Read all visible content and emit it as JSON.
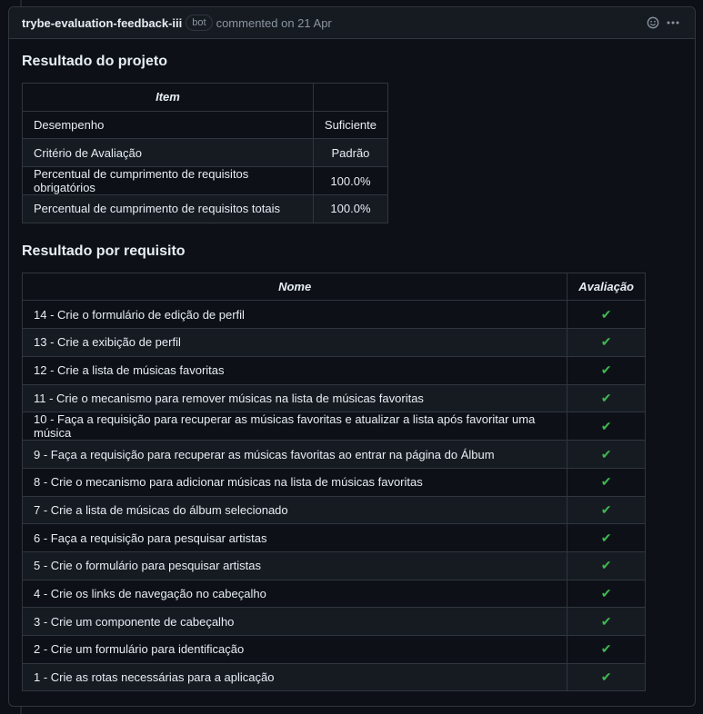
{
  "comment": {
    "author": "trybe-evaluation-feedback-iii",
    "badge": "bot",
    "meta": "commented on 21 Apr"
  },
  "section1": {
    "title": "Resultado do projeto",
    "headers": [
      "Item",
      ""
    ],
    "rows": [
      [
        "Desempenho",
        "Suficiente"
      ],
      [
        "Critério de Avaliação",
        "Padrão"
      ],
      [
        "Percentual de cumprimento de requisitos obrigatórios",
        "100.0%"
      ],
      [
        "Percentual de cumprimento de requisitos totais",
        "100.0%"
      ]
    ]
  },
  "section2": {
    "title": "Resultado por requisito",
    "headers": [
      "Nome",
      "Avaliação"
    ],
    "check_symbol": "✔",
    "check_color": "#3fb950",
    "rows": [
      "14 - Crie o formulário de edição de perfil",
      "13 - Crie a exibição de perfil",
      "12 - Crie a lista de músicas favoritas",
      "11 - Crie o mecanismo para remover músicas na lista de músicas favoritas",
      "10 - Faça a requisição para recuperar as músicas favoritas e atualizar a lista após favoritar uma música",
      "9 - Faça a requisição para recuperar as músicas favoritas ao entrar na página do Álbum",
      "8 - Crie o mecanismo para adicionar músicas na lista de músicas favoritas",
      "7 - Crie a lista de músicas do álbum selecionado",
      "6 - Faça a requisição para pesquisar artistas",
      "5 - Crie o formulário para pesquisar artistas",
      "4 - Crie os links de navegação no cabeçalho",
      "3 - Crie um componente de cabeçalho",
      "2 - Crie um formulário para identificação",
      "1 - Crie as rotas necessárias para a aplicação"
    ]
  },
  "icons": {
    "reaction": "smiley-icon",
    "more": "kebab-horizontal-icon"
  }
}
